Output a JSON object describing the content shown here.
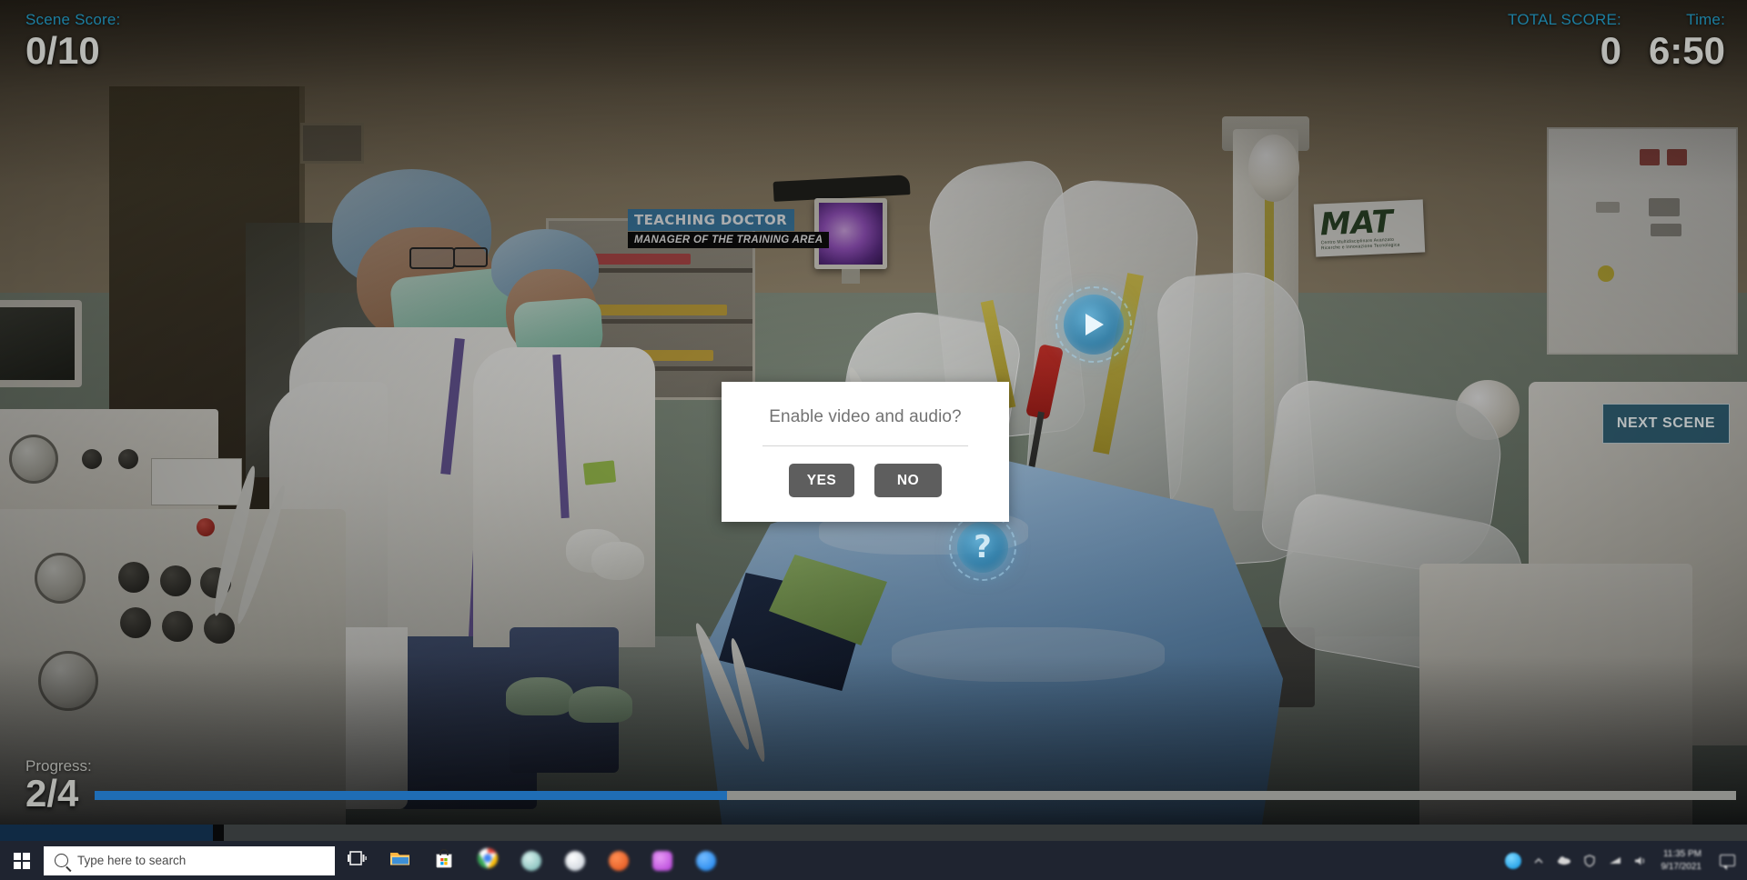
{
  "hud": {
    "scene_score": {
      "label": "Scene Score:",
      "value": "0/10"
    },
    "total_score": {
      "label": "TOTAL SCORE:",
      "value": "0"
    },
    "time": {
      "label": "Time:",
      "value": "6:50"
    },
    "progress": {
      "label": "Progress:",
      "value": "2/4",
      "percent": 38.5
    },
    "next_scene_label": "NEXT SCENE",
    "accent_color": "#1c7ea0",
    "value_color": "#b7b8b4",
    "progress_fill_color": "#1f6db5",
    "progress_track_color": "#8e8f8b"
  },
  "hotspots": {
    "play": {
      "name": "play-hotspot",
      "icon": "play-icon"
    },
    "info": {
      "name": "info-hotspot",
      "icon": "question-mark-icon",
      "glyph": "?"
    }
  },
  "scrubber": {
    "played_percent": 12.2,
    "handle_percent": 12.2
  },
  "scene": {
    "nameplate": {
      "title": "TEACHING DOCTOR",
      "subtitle": "MANAGER OF THE TRAINING AREA",
      "title_bg": "#3d7ea8"
    },
    "wall_sign": {
      "text": "MAT",
      "subtext_line1": "Centro Multidisciplinare Avanzato",
      "subtext_line2": "Ricerche e Innovazione Tecnologica"
    }
  },
  "modal": {
    "title": "Enable video and audio?",
    "yes_label": "YES",
    "no_label": "NO",
    "button_color": "#5e5e5e",
    "background": "#ffffff"
  },
  "taskbar": {
    "start": {
      "name": "start-button",
      "icon": "windows-logo-icon"
    },
    "search": {
      "placeholder": "Type here to search",
      "icon": "search-icon"
    },
    "task_view": {
      "label": "Task View",
      "icon": "task-view-icon"
    },
    "pinned": [
      {
        "name": "file-explorer",
        "icon": "folder-icon",
        "color": "#ffb43f"
      },
      {
        "name": "microsoft-store",
        "icon": "store-icon",
        "color": "#ffffff"
      },
      {
        "name": "chrome",
        "icon": "chrome-icon",
        "color": "#4285f4"
      },
      {
        "name": "app-teal",
        "icon": "circle-icon",
        "color": "#9fd4d0"
      },
      {
        "name": "app-white",
        "icon": "circle-icon",
        "color": "#dfe3e8"
      },
      {
        "name": "app-orange",
        "icon": "circle-icon",
        "color": "#e8622a"
      },
      {
        "name": "app-purple",
        "icon": "circle-icon",
        "color": "#c257e0"
      },
      {
        "name": "app-blue",
        "icon": "circle-icon",
        "color": "#2f8ff0"
      }
    ],
    "tray": {
      "cortana_color": "#2ba6e8",
      "clock_time": "11:35 PM",
      "clock_date": "9/17/2021",
      "action_center_icon": "speech-bubble-icon"
    }
  }
}
